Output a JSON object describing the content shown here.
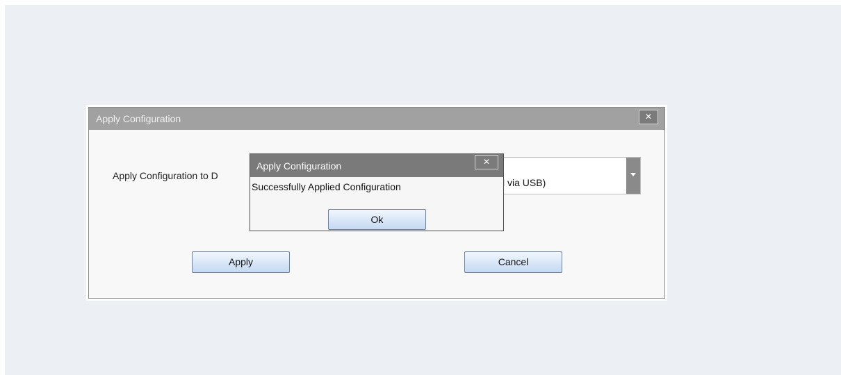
{
  "main_dialog": {
    "title": "Apply Configuration",
    "close_glyph": "✕",
    "device_label": "Apply Configuration to D",
    "device_select_value": "l via USB)",
    "apply_label": "Apply",
    "cancel_label": "Cancel"
  },
  "message_box": {
    "title": "Apply Configuration",
    "close_glyph": "✕",
    "message": "Successfully Applied Configuration",
    "ok_label": "Ok"
  },
  "colors": {
    "background": "#eceff3",
    "main_titlebar": "#a1a1a1",
    "message_titlebar": "#7a7a7a",
    "button_fill": "#d8e6f7"
  },
  "icons": {
    "close": "close-icon",
    "dropdown": "chevron-down-icon"
  }
}
